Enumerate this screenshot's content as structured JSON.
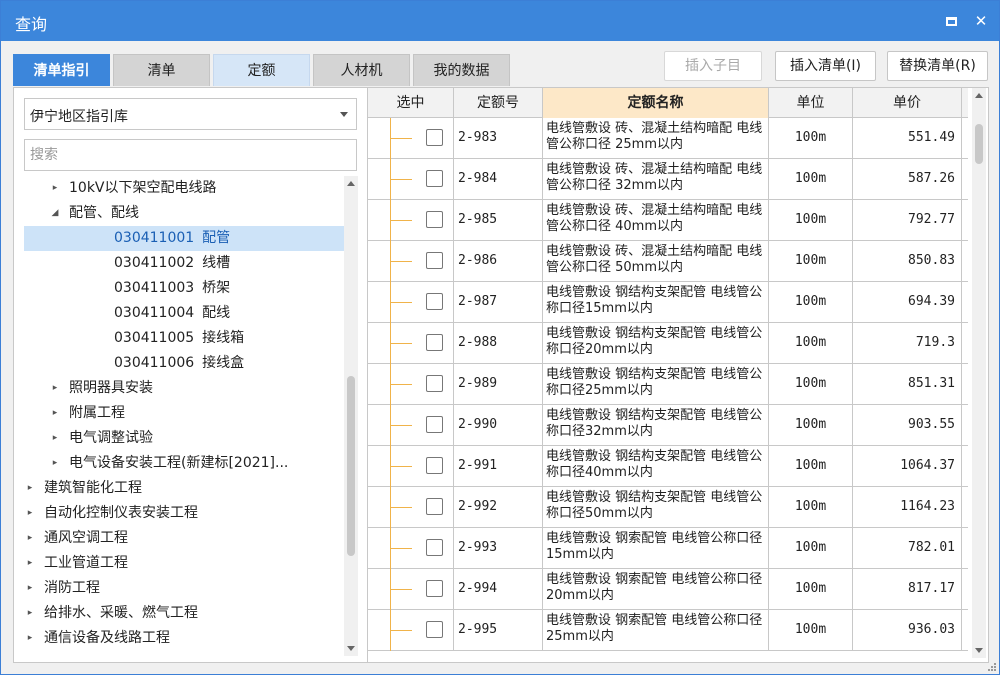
{
  "window": {
    "title": "查询"
  },
  "tabs": [
    {
      "label": "清单指引",
      "state": "active"
    },
    {
      "label": "清单",
      "state": "normal"
    },
    {
      "label": "定额",
      "state": "light"
    },
    {
      "label": "人材机",
      "state": "normal"
    },
    {
      "label": "我的数据",
      "state": "normal"
    }
  ],
  "toolbar": {
    "insert_child": "插入子目",
    "insert_list": "插入清单(I)",
    "replace_list": "替换清单(R)"
  },
  "left": {
    "library_select": "伊宁地区指引库",
    "search_placeholder": "搜索",
    "tree": [
      {
        "label": "10kV以下架空配电线路",
        "level": 2,
        "toggle": "collapsed"
      },
      {
        "label": "配管、配线",
        "level": 2,
        "toggle": "expanded"
      },
      {
        "code": "030411001",
        "label": "配管",
        "level": 3,
        "selected": true
      },
      {
        "code": "030411002",
        "label": "线槽",
        "level": 3
      },
      {
        "code": "030411003",
        "label": "桥架",
        "level": 3
      },
      {
        "code": "030411004",
        "label": "配线",
        "level": 3
      },
      {
        "code": "030411005",
        "label": "接线箱",
        "level": 3
      },
      {
        "code": "030411006",
        "label": "接线盒",
        "level": 3
      },
      {
        "label": "照明器具安装",
        "level": 2,
        "toggle": "collapsed"
      },
      {
        "label": "附属工程",
        "level": 2,
        "toggle": "collapsed"
      },
      {
        "label": "电气调整试验",
        "level": 2,
        "toggle": "collapsed"
      },
      {
        "label": "电气设备安装工程(新建标[2021]...",
        "level": 2,
        "toggle": "collapsed"
      },
      {
        "label": "建筑智能化工程",
        "level": 1,
        "toggle": "collapsed"
      },
      {
        "label": "自动化控制仪表安装工程",
        "level": 1,
        "toggle": "collapsed"
      },
      {
        "label": "通风空调工程",
        "level": 1,
        "toggle": "collapsed"
      },
      {
        "label": "工业管道工程",
        "level": 1,
        "toggle": "collapsed"
      },
      {
        "label": "消防工程",
        "level": 1,
        "toggle": "collapsed"
      },
      {
        "label": "给排水、采暖、燃气工程",
        "level": 1,
        "toggle": "collapsed"
      },
      {
        "label": "通信设备及线路工程",
        "level": 1,
        "toggle": "collapsed"
      }
    ]
  },
  "grid": {
    "columns": [
      "选中",
      "定额号",
      "定额名称",
      "单位",
      "单价"
    ],
    "rows": [
      {
        "code": "2-983",
        "name": "电线管敷设 砖、混凝土结构暗配 电线管公称口径 25mm以内",
        "unit": "100m",
        "price": "551.49"
      },
      {
        "code": "2-984",
        "name": "电线管敷设 砖、混凝土结构暗配 电线管公称口径 32mm以内",
        "unit": "100m",
        "price": "587.26"
      },
      {
        "code": "2-985",
        "name": "电线管敷设 砖、混凝土结构暗配 电线管公称口径 40mm以内",
        "unit": "100m",
        "price": "792.77"
      },
      {
        "code": "2-986",
        "name": "电线管敷设 砖、混凝土结构暗配 电线管公称口径 50mm以内",
        "unit": "100m",
        "price": "850.83"
      },
      {
        "code": "2-987",
        "name": "电线管敷设 钢结构支架配管 电线管公称口径15mm以内",
        "unit": "100m",
        "price": "694.39"
      },
      {
        "code": "2-988",
        "name": "电线管敷设 钢结构支架配管 电线管公称口径20mm以内",
        "unit": "100m",
        "price": "719.3"
      },
      {
        "code": "2-989",
        "name": "电线管敷设 钢结构支架配管 电线管公称口径25mm以内",
        "unit": "100m",
        "price": "851.31"
      },
      {
        "code": "2-990",
        "name": "电线管敷设 钢结构支架配管 电线管公称口径32mm以内",
        "unit": "100m",
        "price": "903.55"
      },
      {
        "code": "2-991",
        "name": "电线管敷设 钢结构支架配管 电线管公称口径40mm以内",
        "unit": "100m",
        "price": "1064.37"
      },
      {
        "code": "2-992",
        "name": "电线管敷设 钢结构支架配管 电线管公称口径50mm以内",
        "unit": "100m",
        "price": "1164.23"
      },
      {
        "code": "2-993",
        "name": "电线管敷设 钢索配管 电线管公称口径15mm以内",
        "unit": "100m",
        "price": "782.01"
      },
      {
        "code": "2-994",
        "name": "电线管敷设 钢索配管 电线管公称口径20mm以内",
        "unit": "100m",
        "price": "817.17"
      },
      {
        "code": "2-995",
        "name": "电线管敷设 钢索配管 电线管公称口径25mm以内",
        "unit": "100m",
        "price": "936.03"
      }
    ]
  },
  "colors": {
    "titlebar": "#3c86db",
    "selected_bg": "#cde3f8",
    "header_highlight": "#fde8c8",
    "tree_line": "#f0b34a"
  },
  "icons": {
    "minimize": "minimize-icon",
    "close": "close-icon",
    "dropdown": "chevron-down-icon",
    "expand": "triangle-right-icon",
    "collapse": "triangle-down-icon"
  }
}
